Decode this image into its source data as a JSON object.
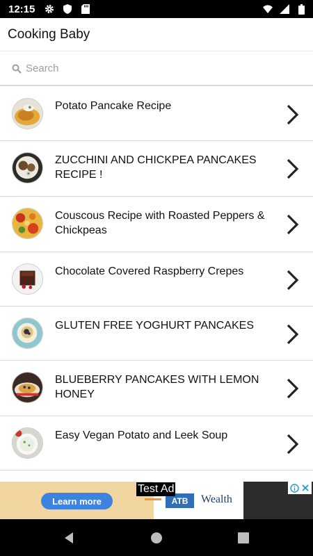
{
  "status_bar": {
    "time": "12:15",
    "left_icons": [
      "gear-icon",
      "shield-icon",
      "sd-card-icon"
    ],
    "right_icons": [
      "wifi-icon",
      "signal-icon",
      "battery-icon"
    ]
  },
  "app_bar": {
    "title": "Cooking Baby"
  },
  "search": {
    "placeholder": "Search",
    "value": ""
  },
  "recipes": [
    {
      "title": "Potato Pancake Recipe"
    },
    {
      "title": "ZUCCHINI AND CHICKPEA PANCAKES RECIPE !"
    },
    {
      "title": "Couscous Recipe with Roasted Peppers & Chickpeas"
    },
    {
      "title": "Chocolate Covered Raspberry Crepes"
    },
    {
      "title": "GLUTEN FREE YOGHURT PANCAKES"
    },
    {
      "title": "BLUEBERRY PANCAKES WITH LEMON HONEY"
    },
    {
      "title": "Easy Vegan Potato and Leek Soup"
    }
  ],
  "ad": {
    "button_label": "Learn more",
    "test_label": "Test Ad",
    "logo_text": "ATB",
    "brand_text": "Wealth",
    "choice_icons": [
      "info-icon",
      "close-icon"
    ]
  },
  "nav_bar": {
    "buttons": [
      "back-icon",
      "home-icon",
      "recents-icon"
    ]
  },
  "colors": {
    "accent": "#3f83e0",
    "ad_bg": "#f2d6a2",
    "divider": "#d6d6d6"
  }
}
